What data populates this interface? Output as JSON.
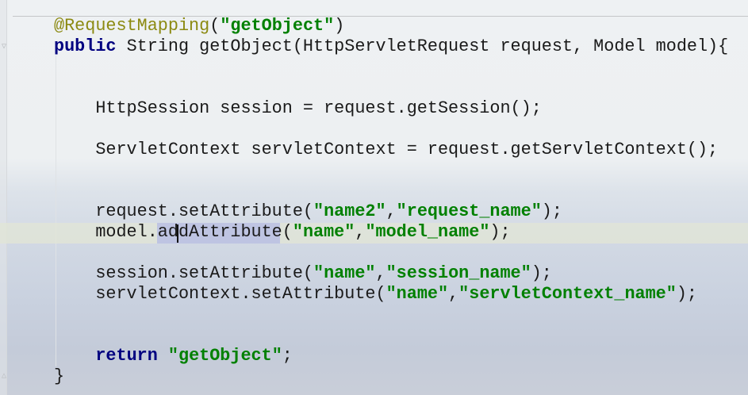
{
  "editor": {
    "language": "java",
    "cursor_line": 11,
    "selected_text": "dAttribute",
    "colors": {
      "annotation": "#8c8a12",
      "keyword": "#000080",
      "string": "#008000",
      "text": "#1a1a1a",
      "current_line": "#e2e6d6",
      "selection": "#b0b6e6"
    },
    "lines": [
      [
        {
          "t": "@RequestMapping",
          "k": "ann"
        },
        {
          "t": "(",
          "k": "plain"
        },
        {
          "t": "\"getObject\"",
          "k": "str"
        },
        {
          "t": ")",
          "k": "plain"
        }
      ],
      [
        {
          "t": "public",
          "k": "kw"
        },
        {
          "t": " String getObject(HttpServletRequest request, Model model){",
          "k": "plain"
        }
      ],
      [],
      [],
      [
        {
          "t": "    HttpSession session = request.getSession();",
          "k": "plain"
        }
      ],
      [],
      [
        {
          "t": "    ServletContext servletContext = request.getServletContext();",
          "k": "plain"
        }
      ],
      [],
      [],
      [
        {
          "t": "    request.setAttribute(",
          "k": "plain"
        },
        {
          "t": "\"name2\"",
          "k": "str"
        },
        {
          "t": ",",
          "k": "plain"
        },
        {
          "t": "\"request_name\"",
          "k": "str"
        },
        {
          "t": ");",
          "k": "plain"
        }
      ],
      [
        {
          "t": "    model.addAttribute(",
          "k": "plain"
        },
        {
          "t": "\"name\"",
          "k": "str"
        },
        {
          "t": ",",
          "k": "plain"
        },
        {
          "t": "\"model_name\"",
          "k": "str"
        },
        {
          "t": ");",
          "k": "plain"
        }
      ],
      [],
      [
        {
          "t": "    session.setAttribute(",
          "k": "plain"
        },
        {
          "t": "\"name\"",
          "k": "str"
        },
        {
          "t": ",",
          "k": "plain"
        },
        {
          "t": "\"session_name\"",
          "k": "str"
        },
        {
          "t": ");",
          "k": "plain"
        }
      ],
      [
        {
          "t": "    servletContext.setAttribute(",
          "k": "plain"
        },
        {
          "t": "\"name\"",
          "k": "str"
        },
        {
          "t": ",",
          "k": "plain"
        },
        {
          "t": "\"servletContext_name\"",
          "k": "str"
        },
        {
          "t": ");",
          "k": "plain"
        }
      ],
      [],
      [],
      [
        {
          "t": "    ",
          "k": "plain"
        },
        {
          "t": "return",
          "k": "kw"
        },
        {
          "t": " ",
          "k": "plain"
        },
        {
          "t": "\"getObject\"",
          "k": "str"
        },
        {
          "t": ";",
          "k": "plain"
        }
      ],
      [
        {
          "t": "}",
          "k": "plain"
        }
      ]
    ]
  }
}
